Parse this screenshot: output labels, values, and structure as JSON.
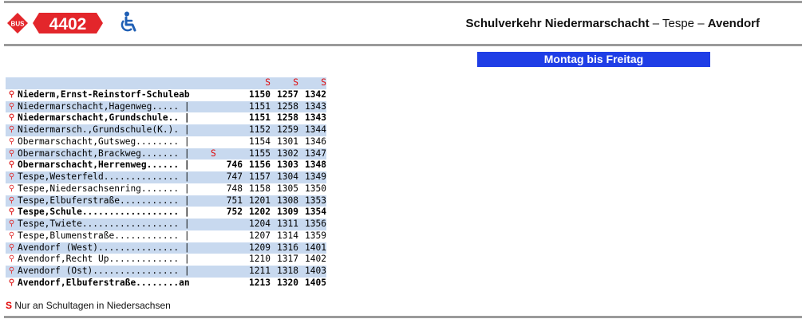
{
  "route": {
    "badge_text": "BUS",
    "number": "4402",
    "accessibility_icon": "wheelchair-icon",
    "title_part1": "Schulverkehr Niedermarschacht",
    "title_sep1": " – ",
    "title_part2": "Tespe",
    "title_sep2": " – ",
    "title_part3": "Avendorf"
  },
  "day_label": "Montag bis Freitag",
  "column_flags": [
    "S",
    "S",
    "S"
  ],
  "stops": [
    {
      "name": "Niederm,Ernst-Reinstorf-Schule",
      "suffix": "ab",
      "flag": "",
      "t0": "",
      "t1": "1150",
      "t2": "1257",
      "t3": "1342",
      "bold": true,
      "shade": false
    },
    {
      "name": "Niedermarschacht,Hagenweg.....",
      "suffix": " |",
      "flag": "",
      "t0": "",
      "t1": "1151",
      "t2": "1258",
      "t3": "1343",
      "bold": false,
      "shade": true
    },
    {
      "name": "Niedermarschacht,Grundschule..",
      "suffix": " |",
      "flag": "",
      "t0": "",
      "t1": "1151",
      "t2": "1258",
      "t3": "1343",
      "bold": true,
      "shade": false
    },
    {
      "name": "Niedermarsch.,Grundschule(K.).",
      "suffix": " |",
      "flag": "",
      "t0": "",
      "t1": "1152",
      "t2": "1259",
      "t3": "1344",
      "bold": false,
      "shade": true
    },
    {
      "name": "Obermarschacht,Gutsweg........",
      "suffix": " |",
      "flag": "",
      "t0": "",
      "t1": "1154",
      "t2": "1301",
      "t3": "1346",
      "bold": false,
      "shade": false
    },
    {
      "name": "Obermarschacht,Brackweg.......",
      "suffix": " |",
      "flag": "S",
      "t0": "",
      "t1": "1155",
      "t2": "1302",
      "t3": "1347",
      "bold": false,
      "shade": true
    },
    {
      "name": "Obermarschacht,Herrenweg......",
      "suffix": " |",
      "flag": "",
      "t0": "746",
      "t1": "1156",
      "t2": "1303",
      "t3": "1348",
      "bold": true,
      "shade": false
    },
    {
      "name": "Tespe,Westerfeld..............",
      "suffix": " |",
      "flag": "",
      "t0": "747",
      "t1": "1157",
      "t2": "1304",
      "t3": "1349",
      "bold": false,
      "shade": true
    },
    {
      "name": "Tespe,Niedersachsenring.......",
      "suffix": " |",
      "flag": "",
      "t0": "748",
      "t1": "1158",
      "t2": "1305",
      "t3": "1350",
      "bold": false,
      "shade": false
    },
    {
      "name": "Tespe,Elbuferstraße...........",
      "suffix": " |",
      "flag": "",
      "t0": "751",
      "t1": "1201",
      "t2": "1308",
      "t3": "1353",
      "bold": false,
      "shade": true
    },
    {
      "name": "Tespe,Schule..................",
      "suffix": " |",
      "flag": "",
      "t0": "752",
      "t1": "1202",
      "t2": "1309",
      "t3": "1354",
      "bold": true,
      "shade": false
    },
    {
      "name": "Tespe,Twiete..................",
      "suffix": " |",
      "flag": "",
      "t0": "",
      "t1": "1204",
      "t2": "1311",
      "t3": "1356",
      "bold": false,
      "shade": true
    },
    {
      "name": "Tespe,Blumenstraße............",
      "suffix": " |",
      "flag": "",
      "t0": "",
      "t1": "1207",
      "t2": "1314",
      "t3": "1359",
      "bold": false,
      "shade": false
    },
    {
      "name": "Avendorf (West)...............",
      "suffix": " |",
      "flag": "",
      "t0": "",
      "t1": "1209",
      "t2": "1316",
      "t3": "1401",
      "bold": false,
      "shade": true
    },
    {
      "name": "Avendorf,Recht Up.............",
      "suffix": " |",
      "flag": "",
      "t0": "",
      "t1": "1210",
      "t2": "1317",
      "t3": "1402",
      "bold": false,
      "shade": false
    },
    {
      "name": "Avendorf (Ost)................",
      "suffix": " |",
      "flag": "",
      "t0": "",
      "t1": "1211",
      "t2": "1318",
      "t3": "1403",
      "bold": false,
      "shade": true
    },
    {
      "name": "Avendorf,Elbuferstraße........",
      "suffix": "an",
      "flag": "",
      "t0": "",
      "t1": "1213",
      "t2": "1320",
      "t3": "1405",
      "bold": true,
      "shade": false
    }
  ],
  "legend": {
    "flag": "S",
    "text": " Nur an Schultagen in Niedersachsen"
  }
}
